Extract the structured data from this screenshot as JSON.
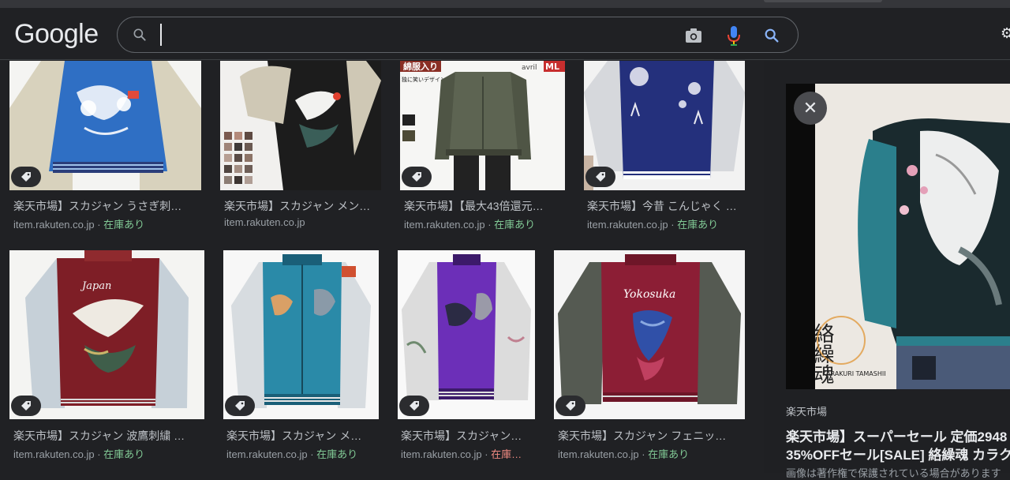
{
  "header": {
    "logo": "Google",
    "search_value": "",
    "right_glyph": "⚙"
  },
  "results": [
    {
      "caption": "楽天市場】スカジャン うさぎ刺…",
      "source": "item.rakuten.co.jp",
      "stock": "在庫あり"
    },
    {
      "caption": "楽天市場】スカジャン メン…",
      "source": "item.rakuten.co.jp",
      "stock": ""
    },
    {
      "caption": "楽天市場】【最大43倍還元…",
      "source": "item.rakuten.co.jp",
      "stock": "在庫あり"
    },
    {
      "caption": "楽天市場】今昔 こんじゃく …",
      "source": "item.rakuten.co.jp",
      "stock": "在庫あり"
    },
    {
      "caption": "楽天市場】スカジャン 波鷹刺繍 …",
      "source": "item.rakuten.co.jp",
      "stock": "在庫あり"
    },
    {
      "caption": "楽天市場】スカジャン メ…",
      "source": "item.rakuten.co.jp",
      "stock": "在庫あり"
    },
    {
      "caption": "楽天市場】スカジャン…",
      "source": "item.rakuten.co.jp",
      "stock": "在庫…"
    },
    {
      "caption": "楽天市場】スカジャン フェニッ…",
      "source": "item.rakuten.co.jp",
      "stock": "在庫あり"
    }
  ],
  "thumb_texts": {
    "r3_banner": "綿服入り",
    "r3_sub": "独に笑いデザインでアイセンスをアピール",
    "r3_badge": "ML",
    "r3_badge2": "avril",
    "r5_text": "Japan",
    "r8_text": "Yokosuka"
  },
  "panel": {
    "logo_kanji": "絡繰魂",
    "logo_roman": "KARAKURI TAMASHII",
    "site": "楽天市場",
    "title_line1": "楽天市場】スーパーセール 定価2948",
    "title_line2": "35%OFFセール[SALE] 絡繰魂 カラク",
    "more": "画像は著作権で保護されている場合があります"
  },
  "colors": {
    "background": "#202124",
    "in_stock": "#81c995",
    "in_stock_partial": "#f28b82"
  }
}
